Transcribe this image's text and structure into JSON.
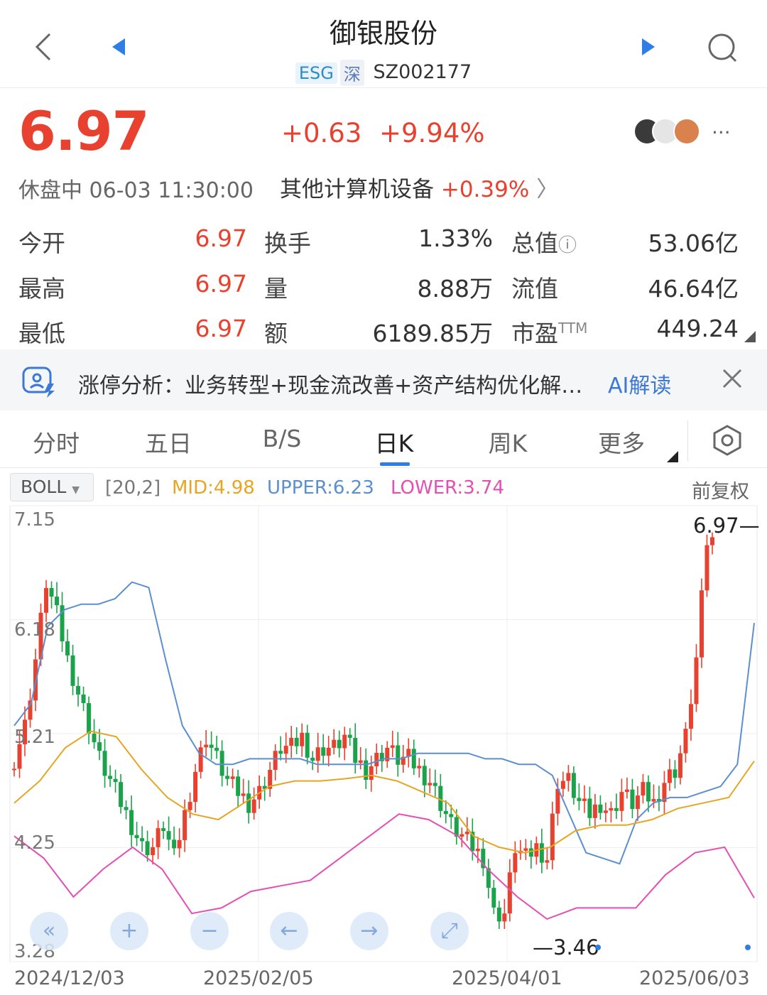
{
  "header": {
    "title": "御银股份",
    "tags": [
      "ESG",
      "深"
    ],
    "code": "SZ002177"
  },
  "quote": {
    "price": "6.97",
    "change": "+0.63",
    "change_pct": "+9.94%",
    "status": "休盘中 06-03 11:30:00",
    "sector": "其他计算机设备",
    "sector_change": "+0.39%"
  },
  "stats": [
    {
      "label": "今开",
      "value": "6.97",
      "label2": "换手",
      "value2": "1.33%",
      "label3": "总值",
      "value3": "53.06亿"
    },
    {
      "label": "最高",
      "value": "6.97",
      "label2": "量",
      "value2": "8.88万",
      "label3": "流值",
      "value3": "46.64亿"
    },
    {
      "label": "最低",
      "value": "6.97",
      "label2": "额",
      "value2": "6189.85万",
      "label3": "市盈",
      "value3": "449.24",
      "label3_sup": "TTM"
    }
  ],
  "analysis": {
    "text": "涨停分析：业务转型+现金流改善+资产结构优化解…",
    "ai_label": "AI解读"
  },
  "tabs": [
    "分时",
    "五日",
    "B/S",
    "日K",
    "周K",
    "更多"
  ],
  "active_tab": 3,
  "indicator": {
    "name": "BOLL",
    "params": "[20,2]",
    "mid": "MID:4.98",
    "upper": "UPPER:6.23",
    "lower": "LOWER:3.74",
    "adjust": "前复权"
  },
  "colors": {
    "up": "#e8412f",
    "down": "#1aa34a",
    "mid_line": "#e6a623",
    "upper_line": "#5b8fd0",
    "lower_line": "#e44fb4"
  },
  "chart_data": {
    "type": "candlestick",
    "y_ticks": [
      "7.15",
      "6.18",
      "5.21",
      "4.25",
      "3.28"
    ],
    "ylim": [
      3.28,
      7.15
    ],
    "x_ticks": [
      "2024/12/03",
      "2025/02/05",
      "2025/04/01",
      "2025/06/03"
    ],
    "max_label": "6.97",
    "min_label": "3.46",
    "close_points": [
      5.0,
      5.3,
      5.9,
      6.6,
      6.3,
      5.9,
      5.6,
      5.3,
      5.0,
      4.8,
      4.6,
      4.4,
      4.2,
      4.2,
      4.4,
      4.1,
      4.5,
      4.9,
      5.2,
      5.0,
      4.8,
      4.7,
      4.6,
      4.7,
      4.9,
      5.1,
      5.1,
      5.2,
      5.0,
      5.1,
      5.1,
      5.2,
      5.0,
      4.9,
      5.0,
      5.1,
      5.0,
      5.0,
      4.9,
      4.8,
      4.6,
      4.4,
      4.3,
      4.2,
      4.1,
      3.6,
      3.6,
      4.2,
      4.1,
      4.2,
      4.1,
      4.8,
      4.8,
      4.6,
      4.5,
      4.6,
      4.5,
      4.7,
      4.6,
      4.7,
      4.6,
      4.8,
      4.9,
      5.2,
      5.9,
      6.97
    ],
    "upper_band": [
      5.3,
      5.5,
      6.2,
      6.35,
      6.4,
      6.4,
      6.45,
      6.6,
      6.55,
      5.9,
      5.3,
      5.05,
      4.95,
      4.95,
      5.0,
      5.0,
      5.0,
      5.0,
      4.95,
      4.95,
      4.95,
      4.95,
      5.0,
      5.0,
      5.05,
      5.05,
      5.05,
      5.05,
      5.0,
      5.0,
      4.95,
      4.95,
      4.85,
      4.5,
      4.15,
      4.1,
      4.05,
      4.45,
      4.6,
      4.65,
      4.65,
      4.7,
      4.75,
      4.95,
      6.23
    ],
    "mid_band": [
      4.6,
      4.8,
      5.1,
      5.25,
      5.2,
      4.9,
      4.65,
      4.5,
      4.45,
      4.6,
      4.75,
      4.8,
      4.8,
      4.82,
      4.85,
      4.8,
      4.7,
      4.6,
      4.3,
      4.2,
      4.15,
      4.2,
      4.35,
      4.4,
      4.4,
      4.45,
      4.55,
      4.6,
      4.65,
      4.98
    ],
    "lower_band": [
      4.3,
      4.1,
      3.75,
      4.0,
      4.2,
      4.0,
      3.6,
      3.65,
      3.8,
      3.85,
      3.9,
      4.1,
      4.3,
      4.5,
      4.45,
      4.3,
      4.0,
      3.75,
      3.55,
      3.65,
      3.65,
      3.65,
      3.95,
      4.15,
      4.2,
      3.74
    ]
  }
}
